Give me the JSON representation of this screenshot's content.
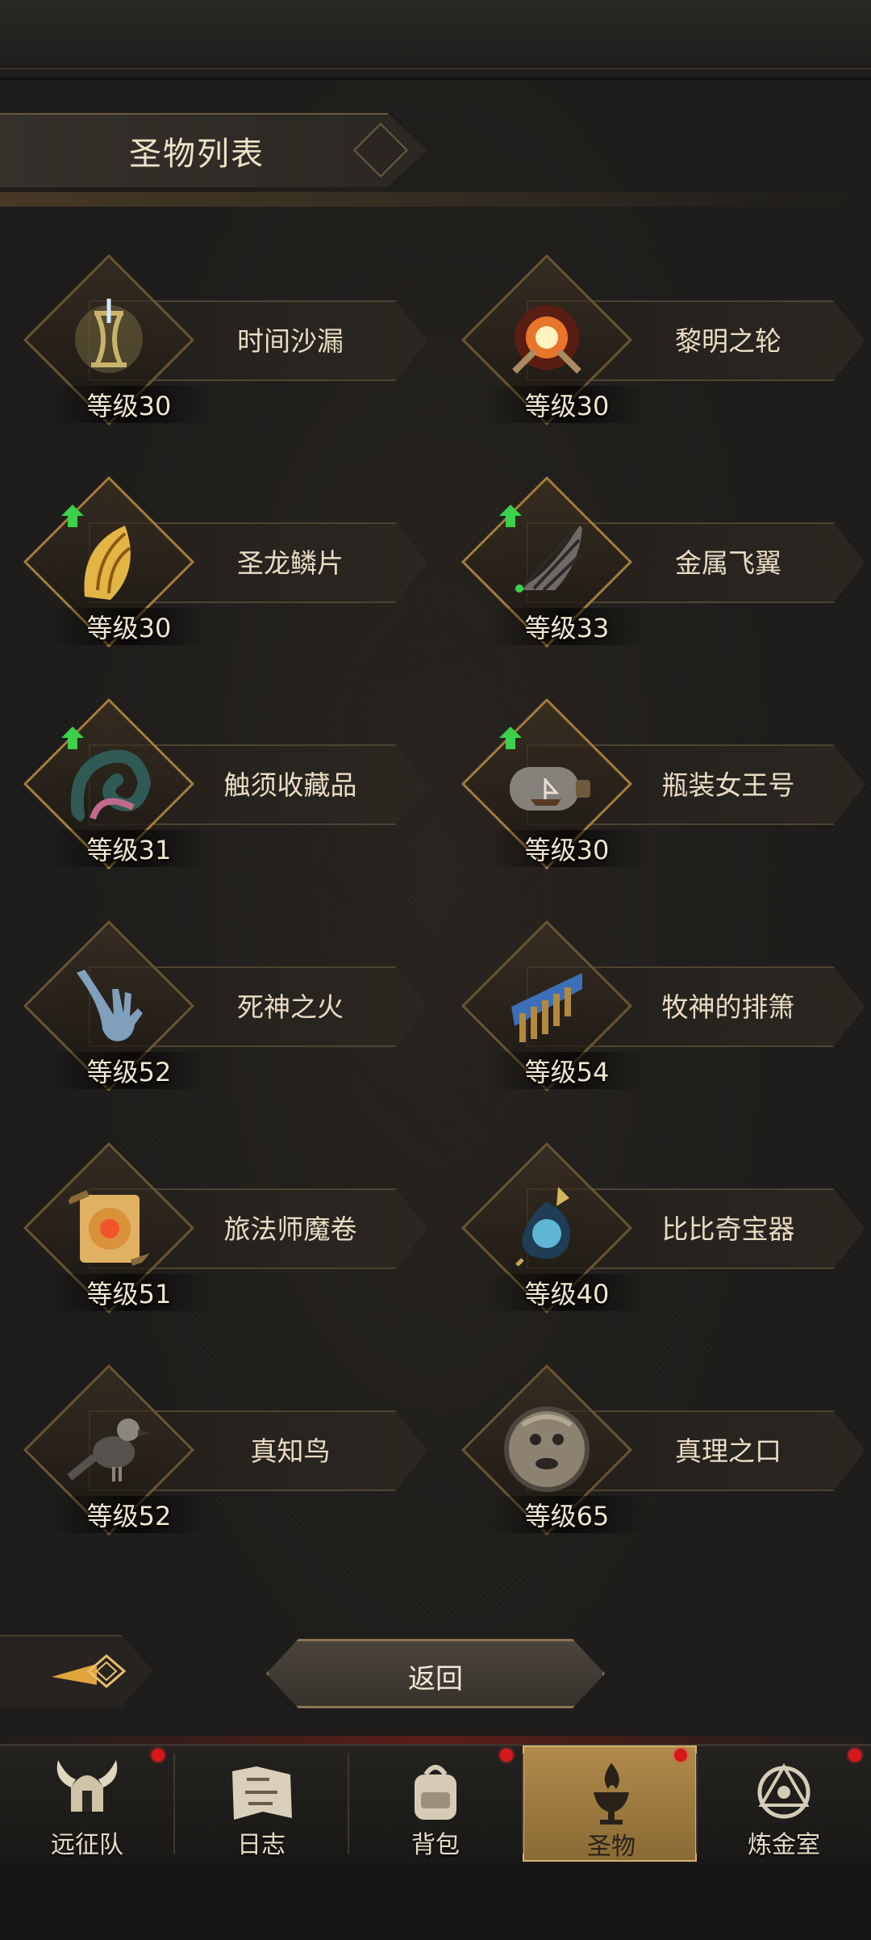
{
  "header": {
    "title": "圣物列表"
  },
  "relics": [
    {
      "name": "时间沙漏",
      "level": "等级30",
      "icon": "hourglass-icon",
      "upgrade": false,
      "color": "#c9b36c"
    },
    {
      "name": "黎明之轮",
      "level": "等级30",
      "icon": "dawn-wheel-icon",
      "upgrade": false,
      "color": "#e8752a"
    },
    {
      "name": "圣龙鳞片",
      "level": "等级30",
      "icon": "dragon-scale-icon",
      "upgrade": true,
      "color": "#e3b545"
    },
    {
      "name": "金属飞翼",
      "level": "等级33",
      "icon": "metal-wing-icon",
      "upgrade": true,
      "color": "#6d6a67"
    },
    {
      "name": "触须收藏品",
      "level": "等级31",
      "icon": "tentacle-icon",
      "upgrade": true,
      "color": "#2f5a56"
    },
    {
      "name": "瓶装女王号",
      "level": "等级30",
      "icon": "ship-bottle-icon",
      "upgrade": true,
      "color": "#9c9a94"
    },
    {
      "name": "死神之火",
      "level": "等级52",
      "icon": "ghost-hand-icon",
      "upgrade": false,
      "color": "#8fb6d8"
    },
    {
      "name": "牧神的排箫",
      "level": "等级54",
      "icon": "pan-flute-icon",
      "upgrade": false,
      "color": "#3c6fb8"
    },
    {
      "name": "旅法师魔卷",
      "level": "等级51",
      "icon": "magic-scroll-icon",
      "upgrade": false,
      "color": "#d9913a"
    },
    {
      "name": "比比奇宝器",
      "level": "等级40",
      "icon": "crystal-vessel-icon",
      "upgrade": false,
      "color": "#5fb6d4"
    },
    {
      "name": "真知鸟",
      "level": "等级52",
      "icon": "crow-icon",
      "upgrade": false,
      "color": "#55524e"
    },
    {
      "name": "真理之口",
      "level": "等级65",
      "icon": "mouth-of-truth-icon",
      "upgrade": false,
      "color": "#8d8170"
    }
  ],
  "actions": {
    "return_label": "返回"
  },
  "tabs": [
    {
      "label": "远征队",
      "icon": "horned-helmet-icon",
      "badge": true,
      "active": false
    },
    {
      "label": "日志",
      "icon": "map-scroll-icon",
      "badge": false,
      "active": false
    },
    {
      "label": "背包",
      "icon": "backpack-icon",
      "badge": true,
      "active": false
    },
    {
      "label": "圣物",
      "icon": "flame-chalice-icon",
      "badge": true,
      "active": true
    },
    {
      "label": "炼金室",
      "icon": "alchemy-icon",
      "badge": true,
      "active": false
    }
  ],
  "colors": {
    "accent_gold": "#a47c3b",
    "badge_red": "#d8161b",
    "upgrade_green": "#3bd14a"
  }
}
